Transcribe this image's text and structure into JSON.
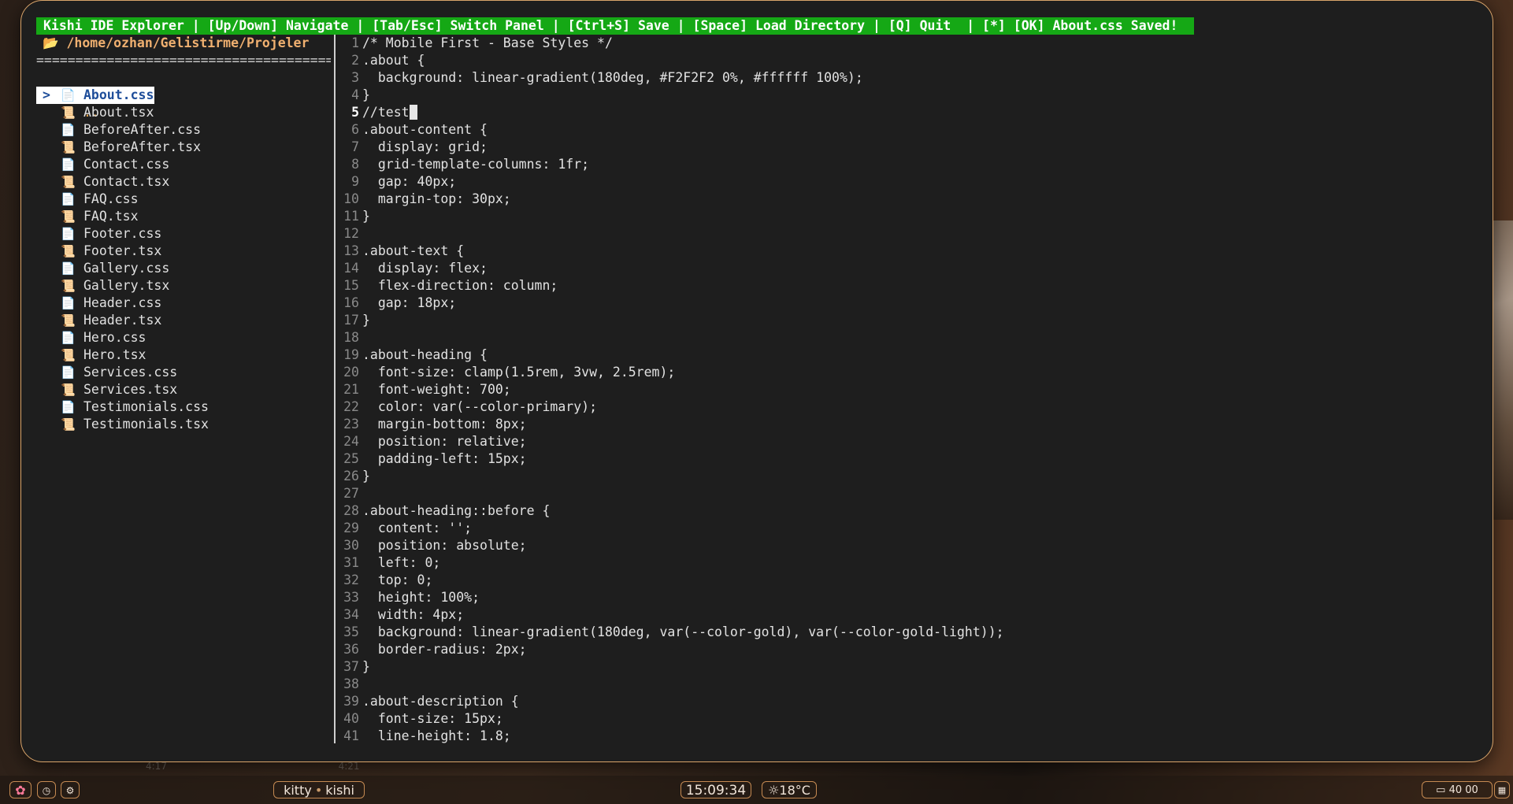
{
  "statusbar": {
    "text": "Kishi IDE Explorer | [Up/Down] Navigate | [Tab/Esc] Switch Panel | [Ctrl+S] Save | [Space] Load Directory | [Q] Quit  | [*] [OK] About.css Saved!"
  },
  "explorer": {
    "path": "📂 /home/ozhan/Gelistirme/Projeler",
    "separator": "==================================================",
    "selected_marker": ">",
    "parent": {
      "icon": "back-arrow-icon",
      "name": ".."
    },
    "files": [
      {
        "name": "About.css",
        "type": "css",
        "selected": true
      },
      {
        "name": "About.tsx",
        "type": "tsx"
      },
      {
        "name": "BeforeAfter.css",
        "type": "css"
      },
      {
        "name": "BeforeAfter.tsx",
        "type": "tsx"
      },
      {
        "name": "Contact.css",
        "type": "css"
      },
      {
        "name": "Contact.tsx",
        "type": "tsx"
      },
      {
        "name": "FAQ.css",
        "type": "css"
      },
      {
        "name": "FAQ.tsx",
        "type": "tsx"
      },
      {
        "name": "Footer.css",
        "type": "css"
      },
      {
        "name": "Footer.tsx",
        "type": "tsx"
      },
      {
        "name": "Gallery.css",
        "type": "css"
      },
      {
        "name": "Gallery.tsx",
        "type": "tsx"
      },
      {
        "name": "Header.css",
        "type": "css"
      },
      {
        "name": "Header.tsx",
        "type": "tsx"
      },
      {
        "name": "Hero.css",
        "type": "css"
      },
      {
        "name": "Hero.tsx",
        "type": "tsx"
      },
      {
        "name": "Services.css",
        "type": "css"
      },
      {
        "name": "Services.tsx",
        "type": "tsx"
      },
      {
        "name": "Testimonials.css",
        "type": "css"
      },
      {
        "name": "Testimonials.tsx",
        "type": "tsx"
      }
    ]
  },
  "editor": {
    "current_line": 5,
    "lines": [
      "/* Mobile First - Base Styles */",
      ".about {",
      "  background: linear-gradient(180deg, #F2F2F2 0%, #ffffff 100%);",
      "}",
      "//test",
      ".about-content {",
      "  display: grid;",
      "  grid-template-columns: 1fr;",
      "  gap: 40px;",
      "  margin-top: 30px;",
      "}",
      "",
      ".about-text {",
      "  display: flex;",
      "  flex-direction: column;",
      "  gap: 18px;",
      "}",
      "",
      ".about-heading {",
      "  font-size: clamp(1.5rem, 3vw, 2.5rem);",
      "  font-weight: 700;",
      "  color: var(--color-primary);",
      "  margin-bottom: 8px;",
      "  position: relative;",
      "  padding-left: 15px;",
      "}",
      "",
      ".about-heading::before {",
      "  content: '';",
      "  position: absolute;",
      "  left: 0;",
      "  top: 0;",
      "  height: 100%;",
      "  width: 4px;",
      "  background: linear-gradient(180deg, var(--color-gold), var(--color-gold-light));",
      "  border-radius: 2px;",
      "}",
      "",
      ".about-description {",
      "  font-size: 15px;",
      "  line-height: 1.8;"
    ]
  },
  "background_labels": [
    "4:17",
    "4:21"
  ],
  "taskbar": {
    "logo_icon": "app-launcher-icon",
    "mini_icons": [
      "timer-icon",
      "settings-icon"
    ],
    "task_app": "kitty",
    "task_title": "kishi",
    "clock": "15:09:34",
    "weather": "☼18°C",
    "tray": "40 00",
    "tray_icon": "battery-icon",
    "end_icon": "calendar-icon"
  },
  "colors": {
    "statusbar_bg": "#15a815",
    "terminal_bg": "#1e1e1e",
    "path_color": "#f0b070",
    "selected_fg": "#1f4e9a",
    "accent_border": "#d9a46a"
  }
}
